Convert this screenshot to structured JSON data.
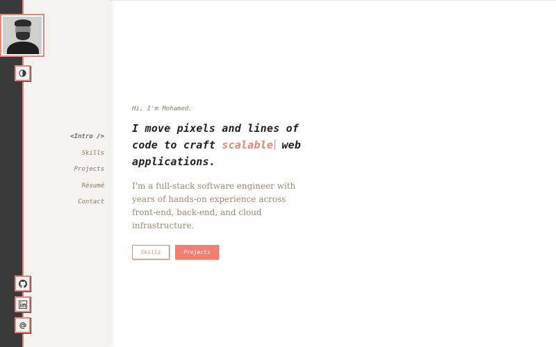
{
  "nav": {
    "items": [
      {
        "label": "<Intro />",
        "active": true
      },
      {
        "label": "Skills",
        "active": false
      },
      {
        "label": "Projects",
        "active": false
      },
      {
        "label": "Résumé",
        "active": false
      },
      {
        "label": "Contact",
        "active": false
      }
    ]
  },
  "icons": {
    "theme": "theme-toggle-icon",
    "github": "github-icon",
    "linkedin": "linkedin-icon",
    "email": "at-sign-icon"
  },
  "hero": {
    "greeting": "Hi, I'm Mohamed.",
    "headline_before": "I move pixels and lines of code to craft ",
    "headline_accent": "scalable",
    "headline_after": " web applications.",
    "description": "I'm a full-stack software engineer with years of hands-on experience across front-end, back-end, and cloud infrastructure.",
    "btn_skills": "Skills",
    "btn_projects": "Projects"
  },
  "colors": {
    "accent": "#e8837a",
    "rail": "#3a3a3a",
    "nav_bg": "#f5f3f0",
    "muted_text": "#8a7a5a"
  }
}
